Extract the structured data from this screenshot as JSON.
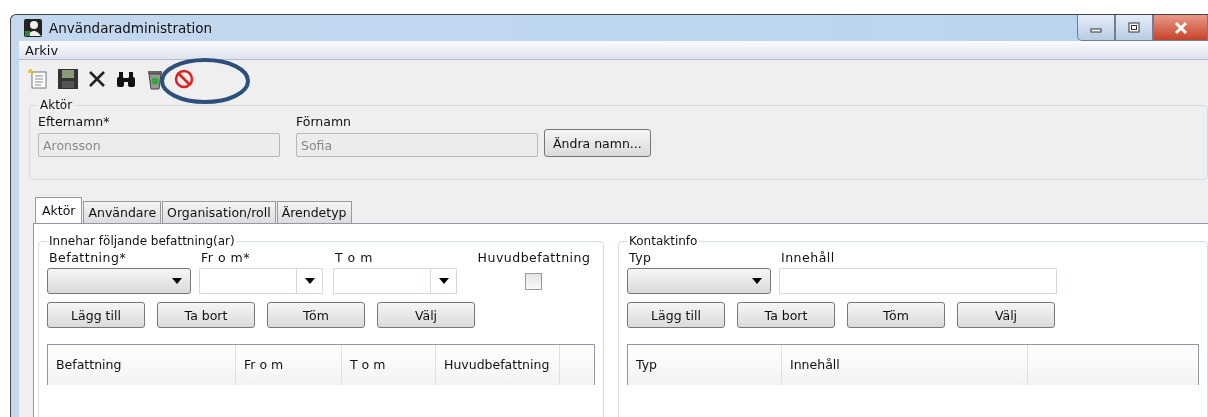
{
  "window": {
    "title": "Användaradministration"
  },
  "menu": [
    {
      "label": "Arkiv"
    }
  ],
  "toolbar": [
    {
      "kind": "new"
    },
    {
      "kind": "save"
    },
    {
      "kind": "delete"
    },
    {
      "kind": "find"
    },
    {
      "kind": "recycle"
    },
    {
      "kind": "block"
    }
  ],
  "actor": {
    "legend": "Aktör",
    "fields": [
      {
        "label": "Efternamn*",
        "value": "Aronsson",
        "disabled": true
      },
      {
        "label": "Förnamn",
        "value": "Sofia",
        "disabled": true
      }
    ],
    "button": "Ändra namn..."
  },
  "tabs": [
    {
      "label": "Aktör",
      "selected": true
    },
    {
      "label": "Användare",
      "selected": false
    },
    {
      "label": "Organisation/roll",
      "selected": false
    },
    {
      "label": "Ärendetyp",
      "selected": false
    }
  ],
  "positions": {
    "legend": "Innehar följande befattning(ar)",
    "fields": [
      {
        "label": "Befattning*",
        "kind": "dropdown"
      },
      {
        "label": "Fr o m*",
        "kind": "date"
      },
      {
        "label": "T o m",
        "kind": "date"
      },
      {
        "label": "Huvudbefattning",
        "kind": "checkbox",
        "checked": false
      }
    ],
    "buttons": [
      "Lägg till",
      "Ta bort",
      "Töm",
      "Välj"
    ],
    "columns": [
      "Befattning",
      "Fr o m",
      "T o m",
      "Huvudbefattning"
    ]
  },
  "contact": {
    "legend": "Kontaktinfo",
    "fields": [
      {
        "label": "Typ",
        "kind": "dropdown"
      },
      {
        "label": "Innehåll",
        "kind": "text"
      }
    ],
    "buttons": [
      "Lägg till",
      "Ta bort",
      "Töm",
      "Välj"
    ],
    "columns": [
      "Typ",
      "Innehåll"
    ]
  }
}
